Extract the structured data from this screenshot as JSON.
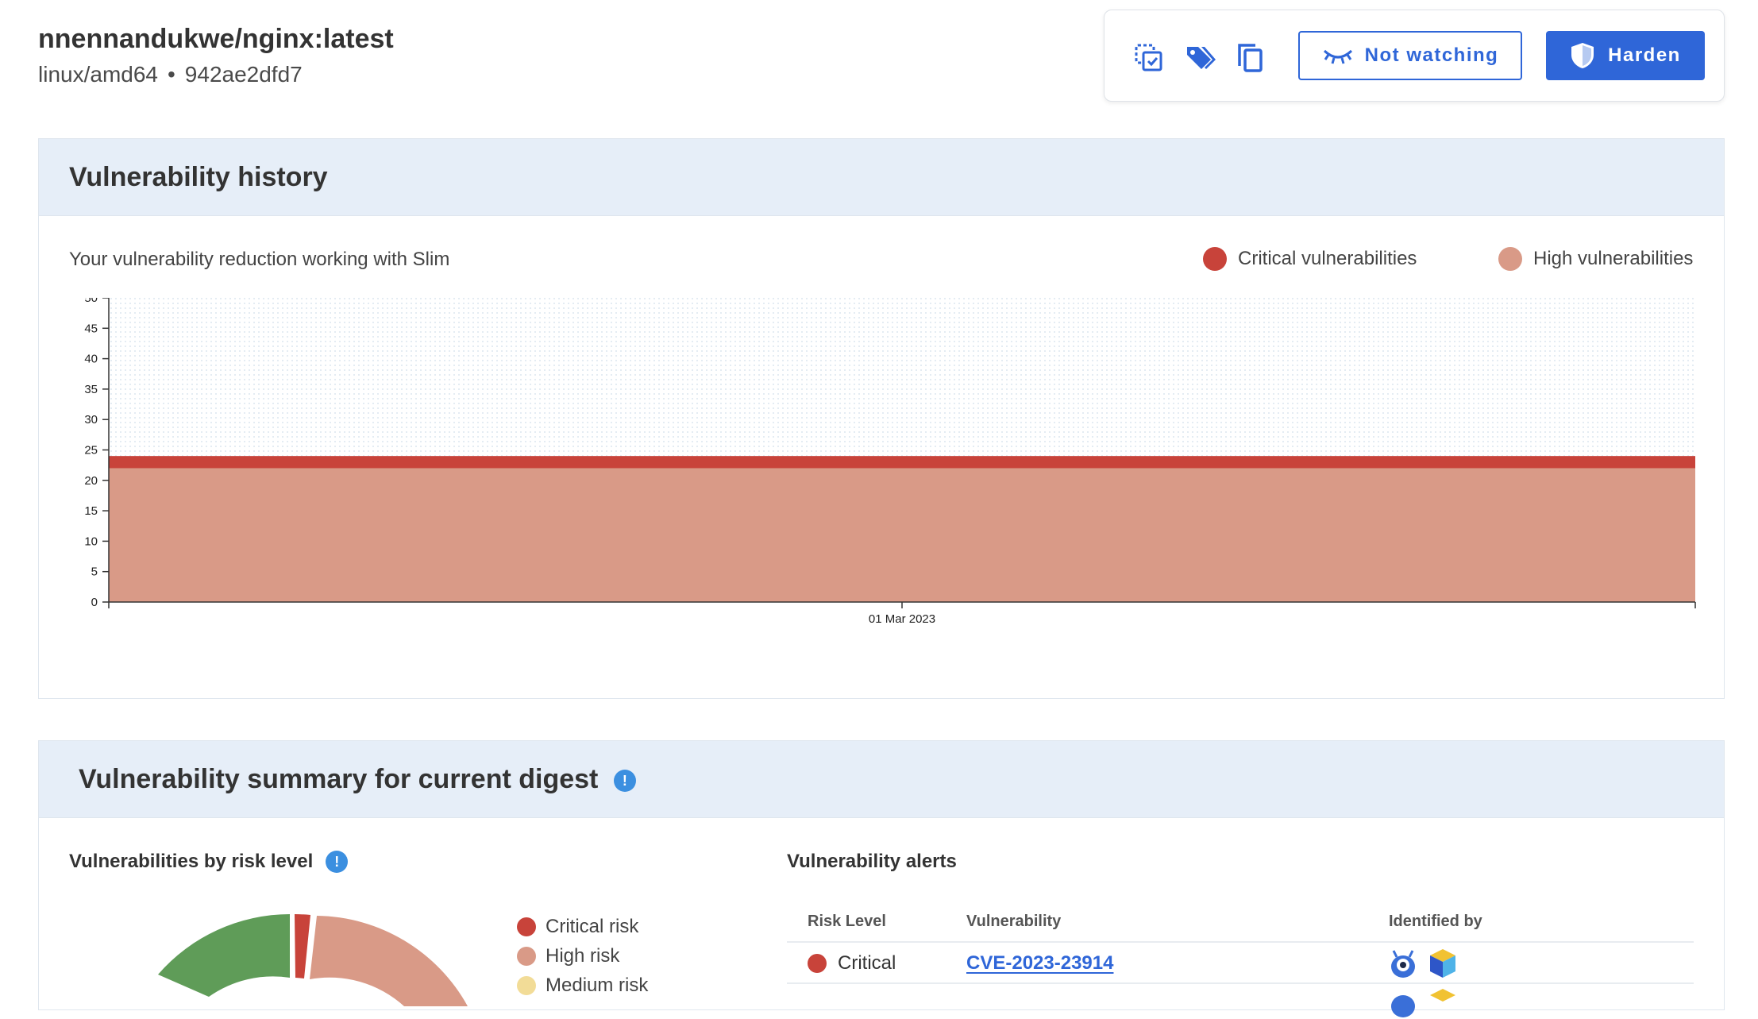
{
  "image": {
    "title": "nnennandukwe/nginx:latest",
    "platform": "linux/amd64",
    "separator": "•",
    "digest": "942ae2dfd7"
  },
  "toolbar": {
    "icons": [
      "compare-icon",
      "tag-icon",
      "copy-icon"
    ],
    "watch_label": "Not watching",
    "harden_label": "Harden",
    "accent_color": "#2f66d8"
  },
  "history": {
    "title": "Vulnerability history",
    "subtitle": "Your vulnerability reduction working with Slim",
    "legend": [
      {
        "label": "Critical vulnerabilities",
        "color": "#c8433a"
      },
      {
        "label": "High vulnerabilities",
        "color": "#d99a87"
      }
    ]
  },
  "chart_data": {
    "type": "area",
    "x": [
      "01 Mar 2023"
    ],
    "ylim": [
      0,
      50
    ],
    "yticks": [
      "0",
      "5",
      "10",
      "15",
      "20",
      "25",
      "30",
      "35",
      "40",
      "45",
      "50"
    ],
    "series": [
      {
        "name": "High vulnerabilities",
        "values": [
          22
        ],
        "color": "#d99a87"
      },
      {
        "name": "Critical vulnerabilities",
        "values": [
          2
        ],
        "color": "#c8433a"
      }
    ],
    "stacked": true,
    "grid": "dotted"
  },
  "summary": {
    "title": "Vulnerability summary for current digest",
    "risk_title": "Vulnerabilities by risk level",
    "risk_legend": [
      {
        "label": "Critical risk",
        "color": "#c8433a"
      },
      {
        "label": "High risk",
        "color": "#d99a87"
      },
      {
        "label": "Medium risk",
        "color": "#f2dc97"
      }
    ],
    "donut_colors": {
      "critical": "#c8433a",
      "high": "#d99a87",
      "other": "#5f9c58"
    },
    "alerts_title": "Vulnerability alerts",
    "columns": [
      "Risk Level",
      "Vulnerability",
      "Identified by"
    ],
    "rows": [
      {
        "risk": "Critical",
        "risk_color": "#c8433a",
        "cve": "CVE-2023-23914",
        "scanners": [
          "grype-scanner-icon",
          "trivy-scanner-icon"
        ]
      }
    ],
    "info_symbol": "!"
  }
}
